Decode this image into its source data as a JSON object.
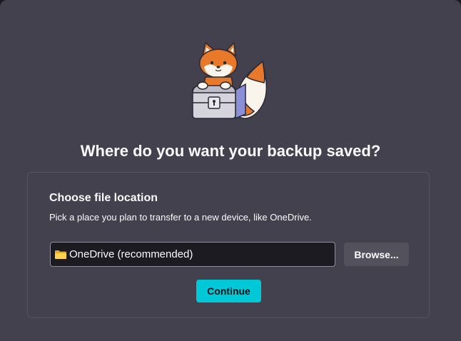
{
  "dialog": {
    "title": "Where do you want your backup saved?"
  },
  "mascot": {
    "icon": "fox-with-lockbox-icon"
  },
  "card": {
    "heading": "Choose file location",
    "description": "Pick a place you plan to transfer to a new device, like OneDrive.",
    "location_value": "OneDrive (recommended)",
    "location_icon": "folder-icon",
    "browse_label": "Browse...",
    "continue_label": "Continue"
  },
  "colors": {
    "background": "#42414d",
    "field_background": "#1c1b22",
    "accent": "#00c8d7",
    "text": "#fbfbfe"
  }
}
